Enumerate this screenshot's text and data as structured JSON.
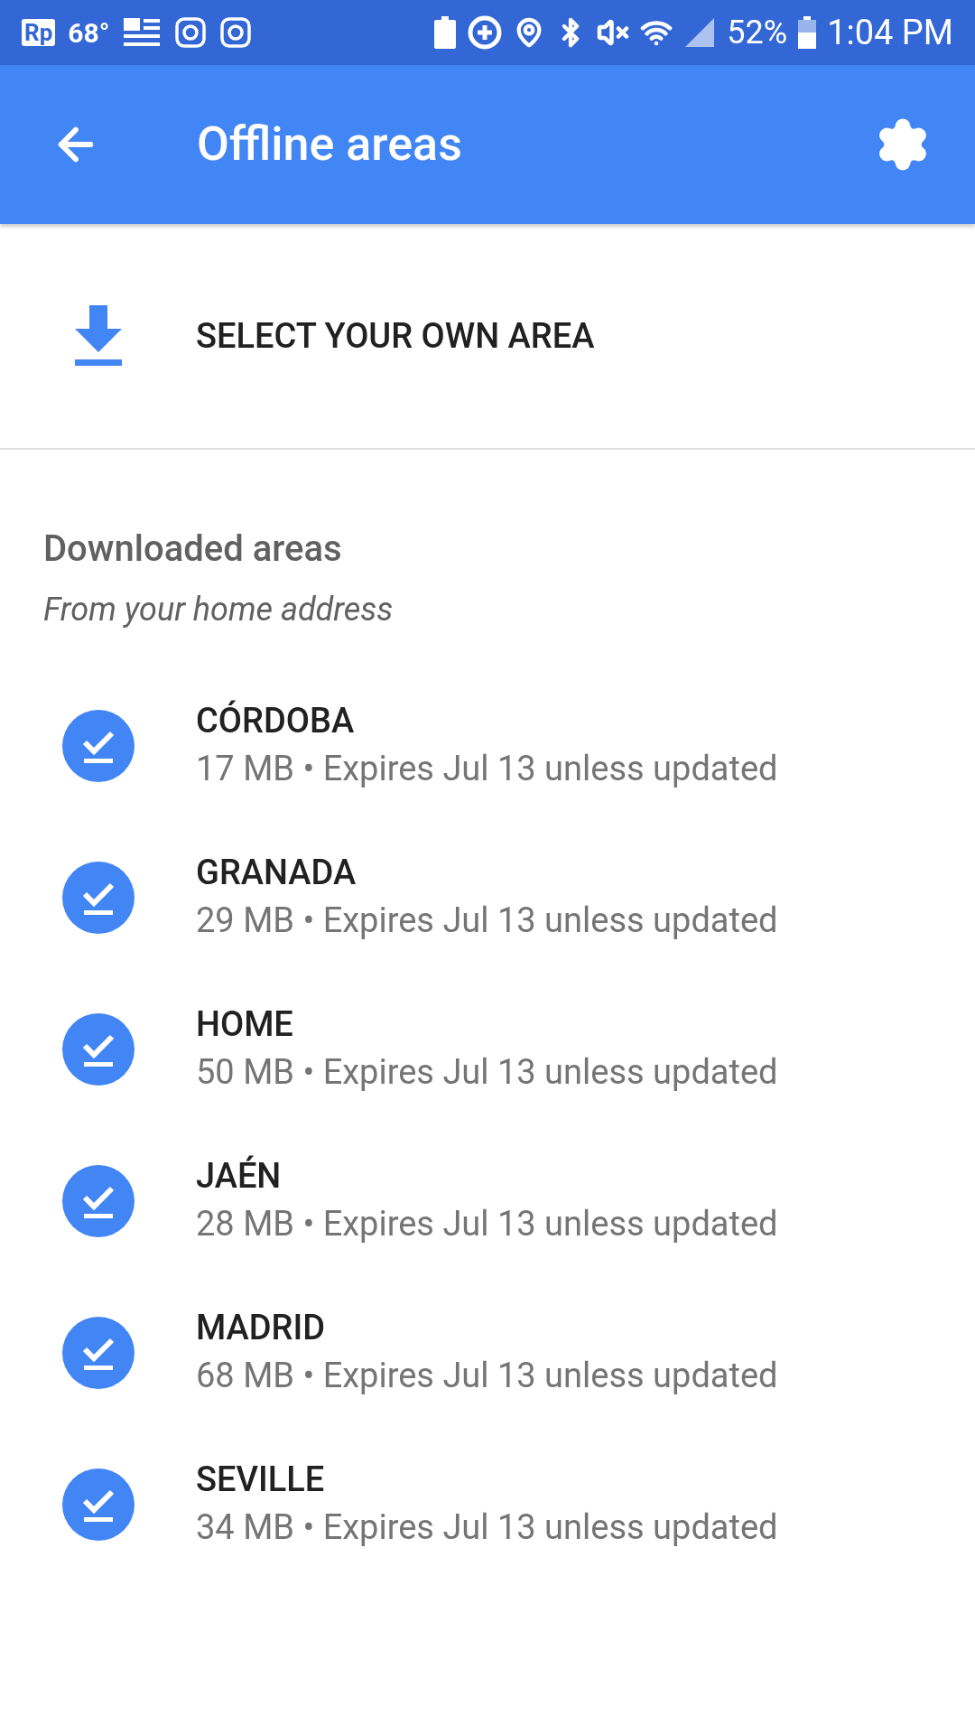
{
  "status_bar": {
    "logo": "Rp",
    "temperature": "68°",
    "battery_percent": "52%",
    "time": "1:04 PM"
  },
  "app_bar": {
    "title": "Offline areas"
  },
  "select_area": {
    "label": "SELECT YOUR OWN AREA"
  },
  "section": {
    "title": "Downloaded areas",
    "subtitle": "From your home address"
  },
  "areas": [
    {
      "name": "CÓRDOBA",
      "details": "17 MB • Expires Jul 13 unless updated",
      "downloaded": true
    },
    {
      "name": "GRANADA",
      "details": "29 MB • Expires Jul 13 unless updated",
      "downloaded": true
    },
    {
      "name": "HOME",
      "details": "50 MB • Expires Jul 13 unless updated",
      "downloaded": true
    },
    {
      "name": "JAÉN",
      "details": "28 MB • Expires Jul 13 unless updated",
      "downloaded": true
    },
    {
      "name": "MADRID",
      "details": "68 MB • Expires Jul 13 unless updated",
      "downloaded": true
    },
    {
      "name": "SEVILLE",
      "details": "34 MB • Expires Jul 13 unless updated",
      "downloaded": true
    }
  ]
}
